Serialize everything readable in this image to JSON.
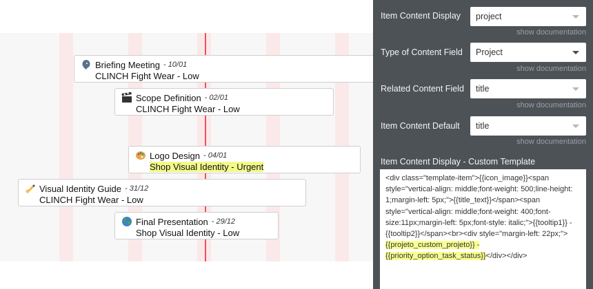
{
  "timeline": {
    "items": [
      {
        "title": "Briefing Meeting",
        "date": "10/01",
        "project": "CLINCH Fight Wear",
        "separator": " - ",
        "priority": "Low",
        "icon": "speaking-head-icon",
        "highlight": false
      },
      {
        "title": "Scope Definition",
        "date": "02/01",
        "project": "CLINCH Fight Wear",
        "separator": " - ",
        "priority": "Low",
        "icon": "clapper-board-icon",
        "highlight": false
      },
      {
        "title": "Logo Design",
        "date": "04/01",
        "project": "Shop Visual Identity",
        "separator": " - ",
        "priority": "Urgent",
        "icon": "palette-icon",
        "highlight": true
      },
      {
        "title": "Visual Identity Guide",
        "date": "31/12",
        "project": "CLINCH Fight Wear",
        "separator": " - ",
        "priority": "Low",
        "icon": "writing-hand-icon",
        "highlight": false
      },
      {
        "title": "Final Presentation",
        "date": "29/12",
        "project": "Shop Visual Identity",
        "separator": " - ",
        "priority": "Low",
        "icon": "globe-icon",
        "highlight": false
      }
    ]
  },
  "panel": {
    "fields": [
      {
        "label": "Item Content Display",
        "value": "project",
        "doc": "show documentation"
      },
      {
        "label": "Type of Content Field",
        "value": "Project",
        "doc": "show documentation"
      },
      {
        "label": "Related Content Field",
        "value": "title",
        "doc": "show documentation"
      },
      {
        "label": "Item Content Default",
        "value": "title",
        "doc": "show documentation"
      }
    ],
    "template_label": "Item Content Display - Custom Template",
    "template_code": "<div class=\"template-item\">{{icon_image}}<span style=\"vertical-align: middle;font-weight: 500;line-height: 1;margin-left: 5px;\">{{title_text}}</span><span style=\"vertical-align: middle;font-weight: 400;font-size:11px;margin-left: 5px;font-style: italic;\">{{tooltip1}} - {{tooltip2}}</span><br><div style=\"margin-left: 22px;\">",
    "template_hl1": "{{projeto_custom_projeto}} -",
    "template_hl2": "{{priority_option_task_status}}",
    "template_tail": "</div></div>"
  },
  "colors": {
    "panel_bg": "#4d5257",
    "today_line": "#f0505a",
    "highlight": "#f2f98a"
  }
}
